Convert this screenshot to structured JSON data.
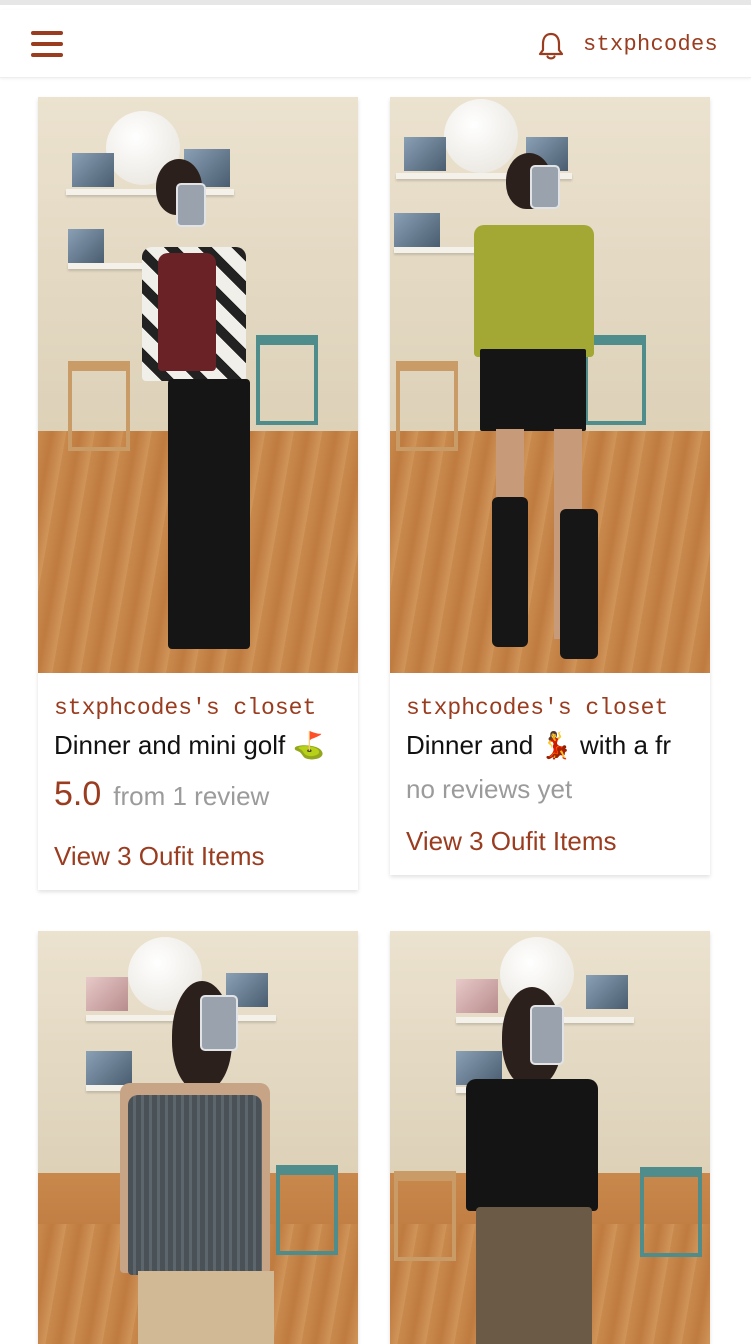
{
  "header": {
    "menu_icon": "hamburger-menu-icon",
    "bell_icon": "bell-icon",
    "username": "stxphcodes",
    "accent_color": "#9a3c1f"
  },
  "outfits": [
    {
      "closet_label": "stxphcodes's closet",
      "title": "Dinner and mini golf ⛳",
      "rating": "5.0",
      "reviews": "from 1 review",
      "view_label": "View 3 Oufit Items"
    },
    {
      "closet_label": "stxphcodes's closet",
      "title": "Dinner and 💃 with a fr",
      "no_reviews": "no reviews yet",
      "view_label": "View 3 Oufit Items"
    },
    {},
    {}
  ]
}
